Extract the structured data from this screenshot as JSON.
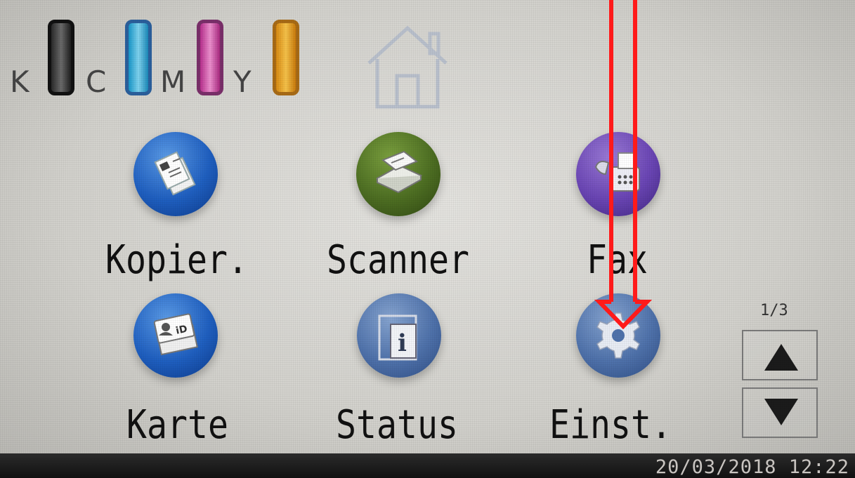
{
  "ink_levels": {
    "items": [
      {
        "letter": "K",
        "color": "#222222"
      },
      {
        "letter": "C",
        "color": "#2aa6d8"
      },
      {
        "letter": "M",
        "color": "#d44ba8"
      },
      {
        "letter": "Y",
        "color": "#e8a32a"
      }
    ]
  },
  "home": {
    "icon": "home-icon"
  },
  "apps": [
    {
      "label": "Kopier.",
      "icon": "copy-icon",
      "color": "#1f5fc0"
    },
    {
      "label": "Scanner",
      "icon": "scanner-icon",
      "color": "#4d6e22"
    },
    {
      "label": "Fax",
      "icon": "fax-icon",
      "color": "#6a45b4"
    },
    {
      "label": "Karte",
      "icon": "id-card-icon",
      "color": "#1f5fc0"
    },
    {
      "label": "Status",
      "icon": "status-info-icon",
      "color": "#4f72ab"
    },
    {
      "label": "Einst.",
      "icon": "settings-gear-icon",
      "color": "#4f72ab"
    }
  ],
  "paging": {
    "indicator": "1/3",
    "up_icon": "arrow-up-icon",
    "down_icon": "arrow-down-icon"
  },
  "status_bar": {
    "datetime": "20/03/2018 12:22"
  },
  "annotation": {
    "type": "double red arrow pointing down to settings",
    "color": "#ff0000"
  }
}
